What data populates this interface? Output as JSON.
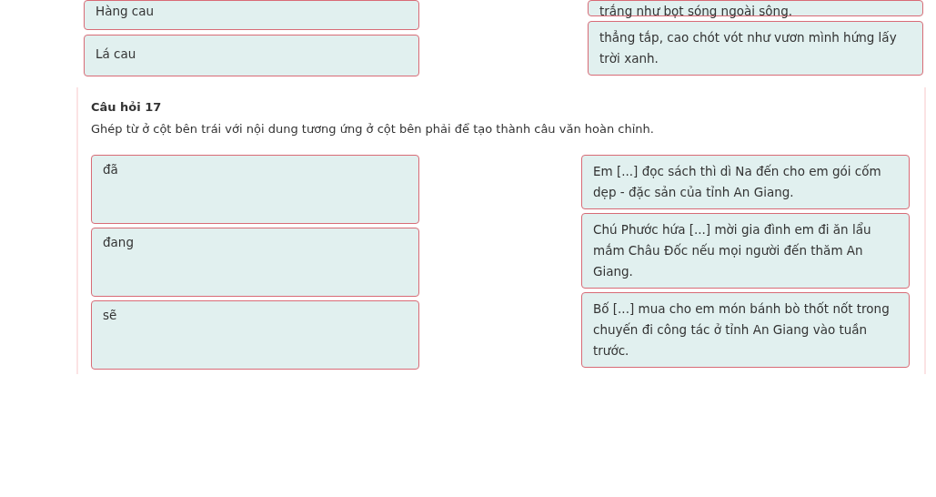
{
  "previous_question": {
    "left_items": [
      "Hàng cau",
      "Lá cau"
    ],
    "right_items": [
      "trắng như bọt sóng ngoài sông.",
      "thẳng tắp, cao chót vót như vươn mình hứng lấy trời xanh."
    ]
  },
  "question": {
    "title": "Câu hỏi 17",
    "instruction": "Ghép từ ở cột bên trái với nội dung tương ứng ở cột bên phải để tạo thành câu văn hoàn chỉnh.",
    "left_items": [
      "đã",
      "đang",
      "sẽ"
    ],
    "right_items": [
      "Em [...] đọc sách thì dì Na đến cho em gói cốm dẹp - đặc sản của tỉnh An Giang.",
      "Chú Phước hứa [...] mời gia đình em đi ăn lẩu mắm Châu Đốc nếu mọi người đến thăm An Giang.",
      "Bố [...] mua cho em món bánh bò thốt nốt trong chuyến đi công tác ở tỉnh An Giang vào tuần trước."
    ]
  }
}
